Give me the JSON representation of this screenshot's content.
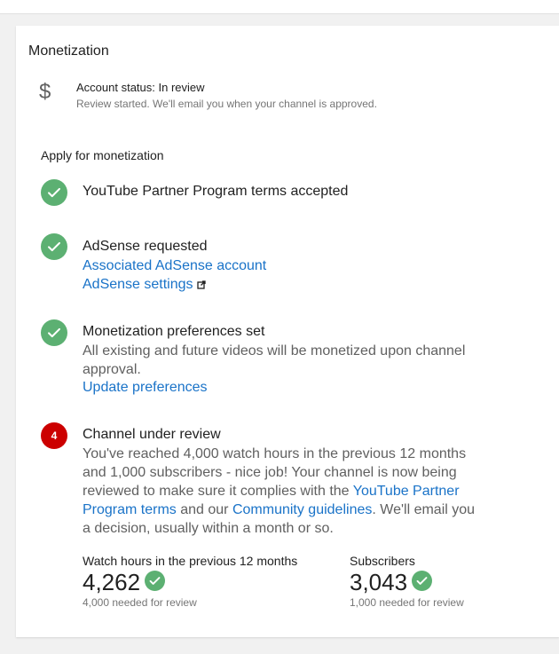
{
  "card": {
    "title": "Monetization",
    "account_status": {
      "icon": "dollar-icon",
      "title": "Account status: In review",
      "subtitle": "Review started. We'll email you when your channel is approved."
    },
    "section_title": "Apply for monetization"
  },
  "steps": [
    {
      "state": "done",
      "icon": "check-icon",
      "title": "YouTube Partner Program terms accepted"
    },
    {
      "state": "done",
      "icon": "check-icon",
      "title": "AdSense requested",
      "links": [
        "Associated AdSense account",
        "AdSense settings"
      ]
    },
    {
      "state": "done",
      "icon": "check-icon",
      "title": "Monetization preferences set",
      "description": "All existing and future videos will be monetized upon channel approval.",
      "link": "Update preferences"
    },
    {
      "state": "pending",
      "number": "4",
      "title": "Channel under review",
      "description_part1": "You've reached 4,000 watch hours in the previous 12 months and 1,000 subscribers - nice job! Your channel is now being reviewed to make sure it complies with the ",
      "link1": "YouTube Partner Program terms",
      "description_part2": " and our ",
      "link2": "Community guidelines",
      "description_part3": ". We'll email you a decision, usually within a month or so."
    }
  ],
  "stats": {
    "watch_hours": {
      "label": "Watch hours in the previous 12 months",
      "value": "4,262",
      "note": "4,000 needed for review"
    },
    "subscribers": {
      "label": "Subscribers",
      "value": "3,043",
      "note": "1,000 needed for review"
    }
  },
  "colors": {
    "success": "#5cb072",
    "pending": "#cc0000",
    "link": "#1a73c8"
  }
}
